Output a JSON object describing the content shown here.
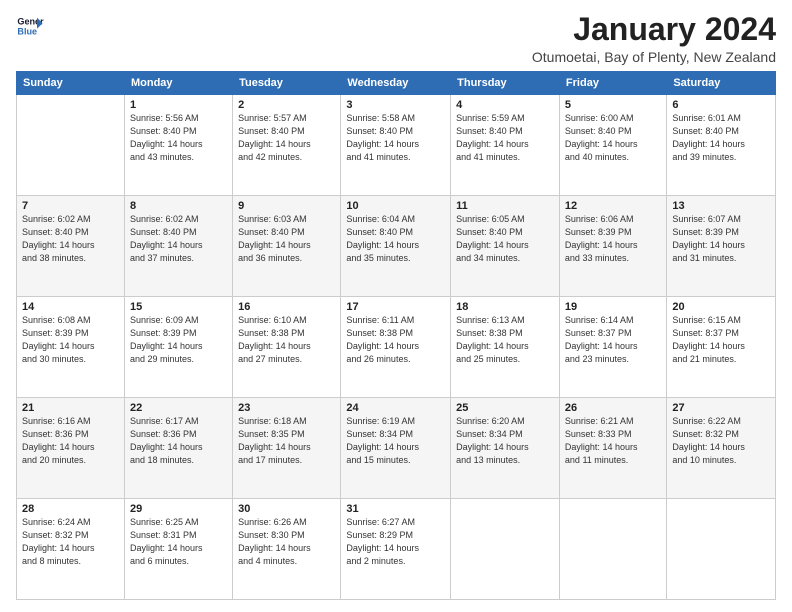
{
  "logo": {
    "text_general": "General",
    "text_blue": "Blue"
  },
  "title": "January 2024",
  "location": "Otumoetai, Bay of Plenty, New Zealand",
  "days_of_week": [
    "Sunday",
    "Monday",
    "Tuesday",
    "Wednesday",
    "Thursday",
    "Friday",
    "Saturday"
  ],
  "weeks": [
    [
      {
        "day": "",
        "info": ""
      },
      {
        "day": "1",
        "info": "Sunrise: 5:56 AM\nSunset: 8:40 PM\nDaylight: 14 hours\nand 43 minutes."
      },
      {
        "day": "2",
        "info": "Sunrise: 5:57 AM\nSunset: 8:40 PM\nDaylight: 14 hours\nand 42 minutes."
      },
      {
        "day": "3",
        "info": "Sunrise: 5:58 AM\nSunset: 8:40 PM\nDaylight: 14 hours\nand 41 minutes."
      },
      {
        "day": "4",
        "info": "Sunrise: 5:59 AM\nSunset: 8:40 PM\nDaylight: 14 hours\nand 41 minutes."
      },
      {
        "day": "5",
        "info": "Sunrise: 6:00 AM\nSunset: 8:40 PM\nDaylight: 14 hours\nand 40 minutes."
      },
      {
        "day": "6",
        "info": "Sunrise: 6:01 AM\nSunset: 8:40 PM\nDaylight: 14 hours\nand 39 minutes."
      }
    ],
    [
      {
        "day": "7",
        "info": "Sunrise: 6:02 AM\nSunset: 8:40 PM\nDaylight: 14 hours\nand 38 minutes."
      },
      {
        "day": "8",
        "info": "Sunrise: 6:02 AM\nSunset: 8:40 PM\nDaylight: 14 hours\nand 37 minutes."
      },
      {
        "day": "9",
        "info": "Sunrise: 6:03 AM\nSunset: 8:40 PM\nDaylight: 14 hours\nand 36 minutes."
      },
      {
        "day": "10",
        "info": "Sunrise: 6:04 AM\nSunset: 8:40 PM\nDaylight: 14 hours\nand 35 minutes."
      },
      {
        "day": "11",
        "info": "Sunrise: 6:05 AM\nSunset: 8:40 PM\nDaylight: 14 hours\nand 34 minutes."
      },
      {
        "day": "12",
        "info": "Sunrise: 6:06 AM\nSunset: 8:39 PM\nDaylight: 14 hours\nand 33 minutes."
      },
      {
        "day": "13",
        "info": "Sunrise: 6:07 AM\nSunset: 8:39 PM\nDaylight: 14 hours\nand 31 minutes."
      }
    ],
    [
      {
        "day": "14",
        "info": "Sunrise: 6:08 AM\nSunset: 8:39 PM\nDaylight: 14 hours\nand 30 minutes."
      },
      {
        "day": "15",
        "info": "Sunrise: 6:09 AM\nSunset: 8:39 PM\nDaylight: 14 hours\nand 29 minutes."
      },
      {
        "day": "16",
        "info": "Sunrise: 6:10 AM\nSunset: 8:38 PM\nDaylight: 14 hours\nand 27 minutes."
      },
      {
        "day": "17",
        "info": "Sunrise: 6:11 AM\nSunset: 8:38 PM\nDaylight: 14 hours\nand 26 minutes."
      },
      {
        "day": "18",
        "info": "Sunrise: 6:13 AM\nSunset: 8:38 PM\nDaylight: 14 hours\nand 25 minutes."
      },
      {
        "day": "19",
        "info": "Sunrise: 6:14 AM\nSunset: 8:37 PM\nDaylight: 14 hours\nand 23 minutes."
      },
      {
        "day": "20",
        "info": "Sunrise: 6:15 AM\nSunset: 8:37 PM\nDaylight: 14 hours\nand 21 minutes."
      }
    ],
    [
      {
        "day": "21",
        "info": "Sunrise: 6:16 AM\nSunset: 8:36 PM\nDaylight: 14 hours\nand 20 minutes."
      },
      {
        "day": "22",
        "info": "Sunrise: 6:17 AM\nSunset: 8:36 PM\nDaylight: 14 hours\nand 18 minutes."
      },
      {
        "day": "23",
        "info": "Sunrise: 6:18 AM\nSunset: 8:35 PM\nDaylight: 14 hours\nand 17 minutes."
      },
      {
        "day": "24",
        "info": "Sunrise: 6:19 AM\nSunset: 8:34 PM\nDaylight: 14 hours\nand 15 minutes."
      },
      {
        "day": "25",
        "info": "Sunrise: 6:20 AM\nSunset: 8:34 PM\nDaylight: 14 hours\nand 13 minutes."
      },
      {
        "day": "26",
        "info": "Sunrise: 6:21 AM\nSunset: 8:33 PM\nDaylight: 14 hours\nand 11 minutes."
      },
      {
        "day": "27",
        "info": "Sunrise: 6:22 AM\nSunset: 8:32 PM\nDaylight: 14 hours\nand 10 minutes."
      }
    ],
    [
      {
        "day": "28",
        "info": "Sunrise: 6:24 AM\nSunset: 8:32 PM\nDaylight: 14 hours\nand 8 minutes."
      },
      {
        "day": "29",
        "info": "Sunrise: 6:25 AM\nSunset: 8:31 PM\nDaylight: 14 hours\nand 6 minutes."
      },
      {
        "day": "30",
        "info": "Sunrise: 6:26 AM\nSunset: 8:30 PM\nDaylight: 14 hours\nand 4 minutes."
      },
      {
        "day": "31",
        "info": "Sunrise: 6:27 AM\nSunset: 8:29 PM\nDaylight: 14 hours\nand 2 minutes."
      },
      {
        "day": "",
        "info": ""
      },
      {
        "day": "",
        "info": ""
      },
      {
        "day": "",
        "info": ""
      }
    ]
  ]
}
